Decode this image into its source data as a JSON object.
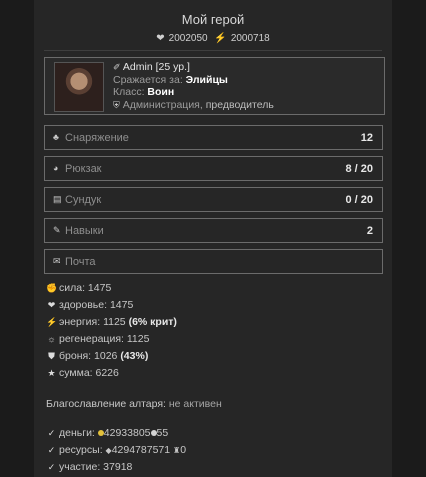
{
  "header": {
    "title": "Мой герой",
    "hp_value": "2002050",
    "energy_value": "2000718"
  },
  "hero": {
    "name": "Admin",
    "level": "[25 ур.]",
    "fights_for_label": "Сражается за:",
    "fights_for_value": "Элийцы",
    "class_label": "Класс:",
    "class_value": "Воин",
    "guild": "Администрация,",
    "guild_rank": "предводитель"
  },
  "menu": [
    {
      "label": "Снаряжение",
      "value": "12",
      "icon": "armor-icon"
    },
    {
      "label": "Рюкзак",
      "value": "8 / 20",
      "icon": "backpack-icon"
    },
    {
      "label": "Сундук",
      "value": "0 / 20",
      "icon": "chest-icon"
    },
    {
      "label": "Навыки",
      "value": "2",
      "icon": "skills-icon"
    },
    {
      "label": "Почта",
      "value": "",
      "icon": "mail-icon"
    }
  ],
  "attributes": {
    "strength": {
      "label": "сила:",
      "value": "1475"
    },
    "health": {
      "label": "здоровье:",
      "value": "1475"
    },
    "energy": {
      "label": "энергия:",
      "value": "1125",
      "extra": "(6% крит)"
    },
    "regen": {
      "label": "регенерация:",
      "value": "1125"
    },
    "armor": {
      "label": "броня:",
      "value": "1026",
      "extra": "(43%)"
    },
    "total": {
      "label": "сумма:",
      "value": "6226"
    }
  },
  "blessing": {
    "label": "Благославление алтаря:",
    "value": "не активен"
  },
  "resources": {
    "money_label": "деньги:",
    "gold": "42933805",
    "silver": "55",
    "res_label": "ресурсы:",
    "res_value": "4294787571",
    "res_extra": "0",
    "participation_label": "участие:",
    "participation_value": "37918"
  }
}
